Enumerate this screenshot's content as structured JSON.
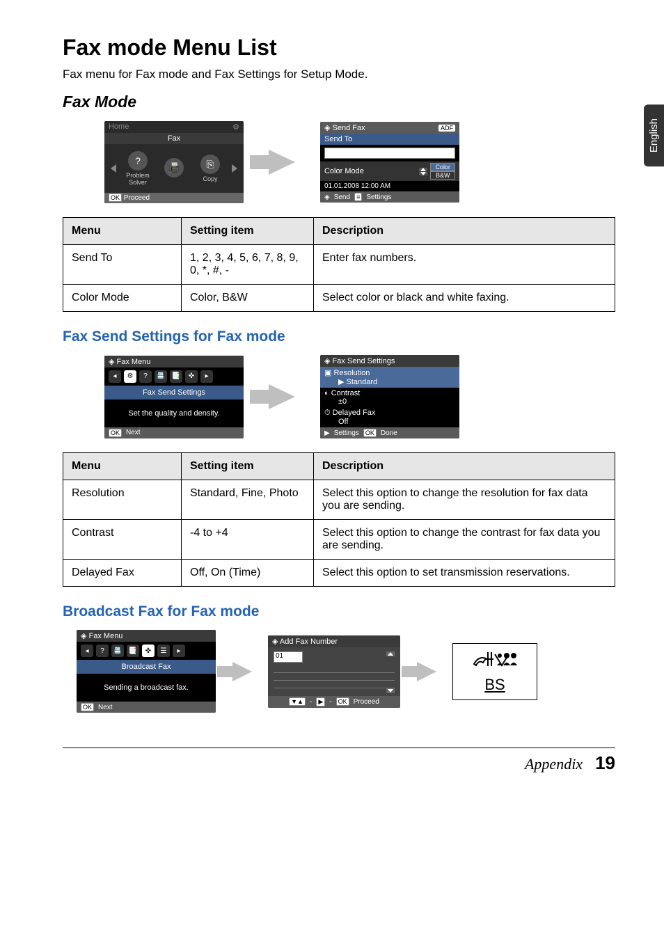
{
  "lang_tab": "English",
  "title": "Fax mode Menu List",
  "subtitle": "Fax menu for Fax mode and Fax Settings for Setup Mode.",
  "section_fax_mode": "Fax Mode",
  "home_lcd": {
    "home": "Home",
    "fax": "Fax",
    "problem": "Problem\nSolver",
    "copy": "Copy",
    "proceed": "Proceed",
    "ok": "OK"
  },
  "sendfax_lcd": {
    "title": "Send Fax",
    "adf": "ADF",
    "send_to": "Send To",
    "color_mode": "Color Mode",
    "color": "Color",
    "bw": "B&W",
    "datetime": "01.01.2008  12:00 AM",
    "send": "Send",
    "settings": "Settings"
  },
  "table1": {
    "headers": [
      "Menu",
      "Setting item",
      "Description"
    ],
    "rows": [
      [
        "Send To",
        "1, 2, 3, 4, 5, 6, 7, 8, 9, 0, *, #, -",
        "Enter fax numbers."
      ],
      [
        "Color Mode",
        "Color, B&W",
        "Select color or black and white faxing."
      ]
    ]
  },
  "section_send_settings": "Fax Send Settings for Fax mode",
  "faxmenu_lcd": {
    "title": "Fax Menu",
    "label": "Fax Send Settings",
    "hint": "Set the quality and density.",
    "next": "Next",
    "ok": "OK"
  },
  "sendsettings_lcd": {
    "title": "Fax Send Settings",
    "rows": [
      {
        "label": "Resolution",
        "value": "Standard"
      },
      {
        "label": "Contrast",
        "value": "±0"
      },
      {
        "label": "Delayed Fax",
        "value": "Off"
      }
    ],
    "settings": "Settings",
    "done": "Done",
    "ok": "OK"
  },
  "table2": {
    "headers": [
      "Menu",
      "Setting item",
      "Description"
    ],
    "rows": [
      [
        "Resolution",
        "Standard, Fine, Photo",
        "Select this option to change the resolution for fax data you are sending."
      ],
      [
        "Contrast",
        "-4 to +4",
        "Select this option to change the contrast for fax data you are sending."
      ],
      [
        "Delayed Fax",
        "Off, On (Time)",
        "Select this option to set transmission reservations."
      ]
    ]
  },
  "section_broadcast": "Broadcast Fax for Fax mode",
  "broadcast_lcd": {
    "title": "Fax Menu",
    "label": "Broadcast Fax",
    "hint": "Sending a broadcast fax.",
    "next": "Next",
    "ok": "OK"
  },
  "addfax_lcd": {
    "title": "Add Fax Number",
    "value": "01",
    "proceed": "Proceed",
    "ok": "OK"
  },
  "bs_icon": {
    "bs": "BS"
  },
  "footer": {
    "appendix": "Appendix",
    "page": "19"
  }
}
